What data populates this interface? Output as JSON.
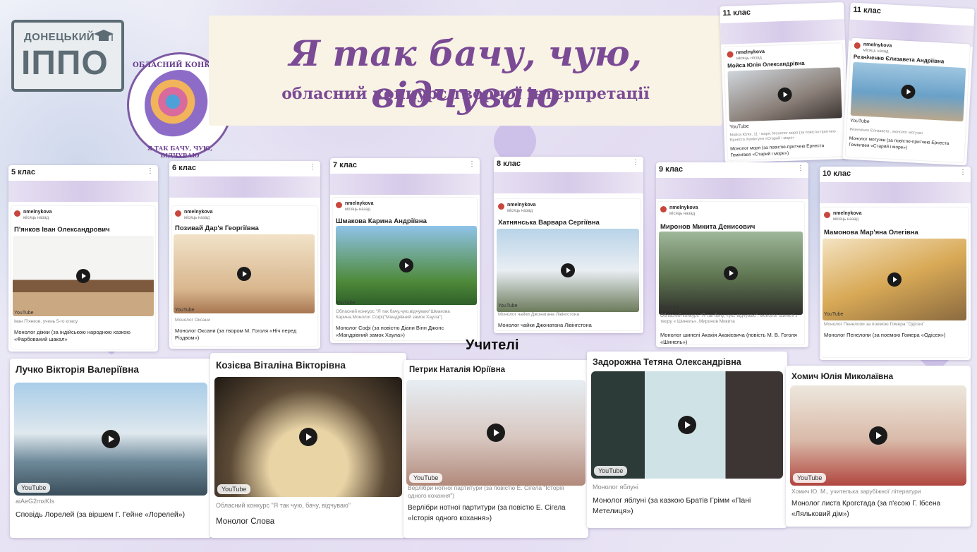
{
  "logo": {
    "top": "ДОНЕЦЬКИЙ",
    "main": "ІППО"
  },
  "seal": {
    "top": "ОБЛАСНИЙ КОНКУРС",
    "bottom": "Я ТАК БАЧУ, ЧУЮ, ВІДЧУВАЮ"
  },
  "banner": {
    "title": "Я так бачу, чую, відчуваю",
    "subtitle": "обласний конкурс творчої інтерпретації"
  },
  "columns": [
    {
      "head": "5 клас",
      "author": "nmelnykova",
      "time": "місяць назад",
      "title": "П'янков Іван Олександрович",
      "yt": "YouTube",
      "meta": "Іван П'янков, учень 5-го класу",
      "desc": "Монолог діжки (за індійською народною казкою «Фарбований шакал»"
    },
    {
      "head": "6 клас",
      "author": "nmelnykova",
      "time": "місяць назад",
      "title": "Позивай Дар'я Георгіївна",
      "yt": "YouTube",
      "meta": "Монолог Оксани",
      "desc": "Монолог Оксани (за твором М. Гоголя «Ніч перед Різдвом»)"
    },
    {
      "head": "7 клас",
      "author": "nmelnykova",
      "time": "місяць назад",
      "title": "Шмакова Карина Андріївна",
      "yt": "YouTube",
      "meta": "Обласний конкурс \"Я так бачу,чую,відчуваю\"Шмакова Карина.Монолог Софі(\"Мандрівний замок Хаула\")",
      "desc": "Монолог Софі (за повістю Діани Вінн Джонс «Мандрівний замок Хаула»)"
    },
    {
      "head": "8 клас",
      "author": "nmelnykova",
      "time": "місяць назад",
      "title": "Хатнянська Варвара Сергіївна",
      "yt": "YouTube",
      "meta": "Монолог чайки Джонатана Лівінгстона",
      "desc": "Монолог чайки Джонатана Лівінгстона"
    },
    {
      "head": "9 клас",
      "author": "nmelnykova",
      "time": "місяць назад",
      "title": "Миронов Микита Денисович",
      "yt": "YouTube",
      "meta": "Обласний конкурс \"Я так бачу, чую, відчуваю\", монолог шинелі з твору « Шинель», Миронов Микита",
      "desc": "Монолог шинелі Акакія Акакієвича (повість М. В. Гоголя «Шинель»)"
    },
    {
      "head": "10 клас",
      "author": "nmelnykova",
      "time": "місяць назад",
      "title": "Мамонова Мар'яна Олегівна",
      "yt": "YouTube",
      "meta": "Монолог Пенелопи за поемою Гомера \"Одісея\"",
      "desc": "Монолог Пенелопи (за поемою Гомера «Одісея»)"
    }
  ],
  "grade11": [
    {
      "head": "11 клас",
      "author": "nmelnykova",
      "time": "місяць назад",
      "title": "Мойса Юлія Олександрівна",
      "yt": "YouTube",
      "meta": "Мойса Юлія, 11 - моря. Монолог моря (за повістю-притчею Ернеста Хемінгуея «Старий і море»",
      "desc": "Монолог моря (за повістю-притчею Ернеста Гемінгвея «Старий і море»)"
    },
    {
      "head": "11 клас",
      "author": "nmelnykova",
      "time": "місяць назад",
      "title": "Резніченко Єлизавета Андріївна",
      "yt": "YouTube",
      "meta": "Резніченко Єлизавета , монолог мотузки",
      "desc": "Монолог мотузки (за повістю-притчею Ернеста Гемінгвея «Старий і море»)"
    }
  ],
  "teachers_label": "Учителі",
  "teachers": [
    {
      "name": "Лучко Вікторія Валеріївна",
      "yt": "YouTube",
      "meta": "aiAeG2mxKIs",
      "desc": "Сповідь Лорелей (за віршем Г. Гейне «Лорелей»)"
    },
    {
      "name": "Козієва Віталіна Вікторівна",
      "yt": "YouTube",
      "meta": "Обласний конкурс \"Я так чую, бачу, відчуваю\"",
      "desc": "Монолог Слова"
    },
    {
      "name": "Петрик Наталія Юріївна",
      "yt": "YouTube",
      "meta": "Верлібри нотної партитури (за повістю Е. Сігела \"Історія одного кохання\")",
      "desc": "Верлібри нотної партитури (за повістю Е. Сігела «Історія одного кохання»)"
    },
    {
      "name": "Задорожна Тетяна Олександрівна",
      "yt": "YouTube",
      "meta": "Монолог яблуні",
      "desc": "Монолог яблуні (за казкою Братів Грімм «Пані Метелиця»)"
    },
    {
      "name": "Хомич Юлія Миколаївна",
      "yt": "YouTube",
      "meta": "Хомич Ю. М., учителька зарубіжної літератури",
      "desc": "Монолог листа Крогстада (за п'єсою Г. Ібсена «Ляльковий дім»)"
    }
  ],
  "colors": {
    "accent": "#7b4a95",
    "logo": "#5d6c74",
    "card": "#ffffff"
  }
}
